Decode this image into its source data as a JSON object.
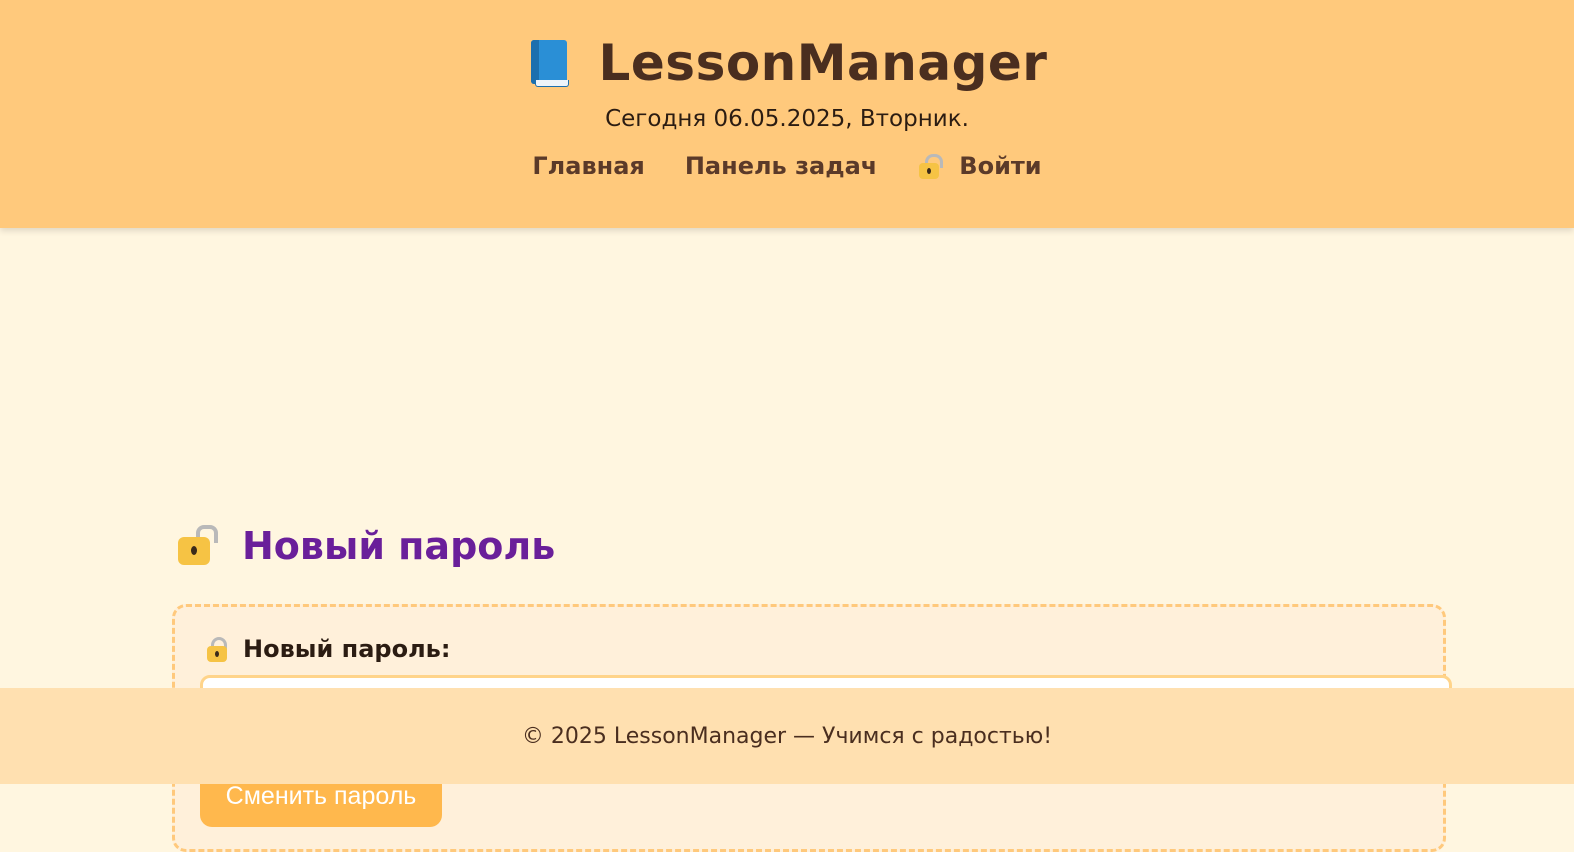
{
  "header": {
    "icon": "book-icon",
    "app_title": "LessonManager",
    "today_text": "Сегодня 06.05.2025, Вторник.",
    "nav": {
      "home_label": "Главная",
      "tasks_label": "Панель задач",
      "login_label": "Войти",
      "login_icon": "lock-icon"
    }
  },
  "main": {
    "page_title": "Новый пароль",
    "title_icon": "lock-with-key-icon",
    "form": {
      "new_password_label": "Новый пароль:",
      "label_icon": "lock-icon",
      "new_password_value": "",
      "submit_label": "Сменить пароль"
    }
  },
  "footer": {
    "text": "© 2025 LessonManager — Учимся с радостью!"
  },
  "colors": {
    "header_bg": "#ffc97c",
    "page_bg": "#fff6e0",
    "title_purple": "#6a1f9a",
    "button_orange": "#ffb84d",
    "footer_bg": "#ffe0b0"
  }
}
